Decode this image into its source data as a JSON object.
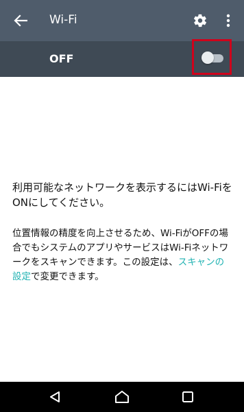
{
  "appbar": {
    "title": "Wi-Fi",
    "back_icon": "back-arrow-icon",
    "settings_icon": "gear-icon",
    "more_icon": "more-vert-icon"
  },
  "wifi_switch": {
    "label": "OFF",
    "state": "off"
  },
  "content": {
    "main_message": "利用可能なネットワークを表示するにはWi-FiをONにしてください。",
    "sub_message_before": "位置情報の精度を向上させるため、Wi-FiがOFFの場合でもシステムのアプリやサービスはWi-Fiネットワークをスキャンできます。この設定は、",
    "sub_message_link": "スキャンの設定",
    "sub_message_after": "で変更できます。"
  },
  "colors": {
    "appbar_bg": "#4f5c6b",
    "switchbar_bg": "#3f4a55",
    "link": "#23b3b3",
    "highlight": "#d0021b"
  },
  "navbar": {
    "back_icon": "nav-back-icon",
    "home_icon": "nav-home-icon",
    "recents_icon": "nav-recents-icon"
  }
}
